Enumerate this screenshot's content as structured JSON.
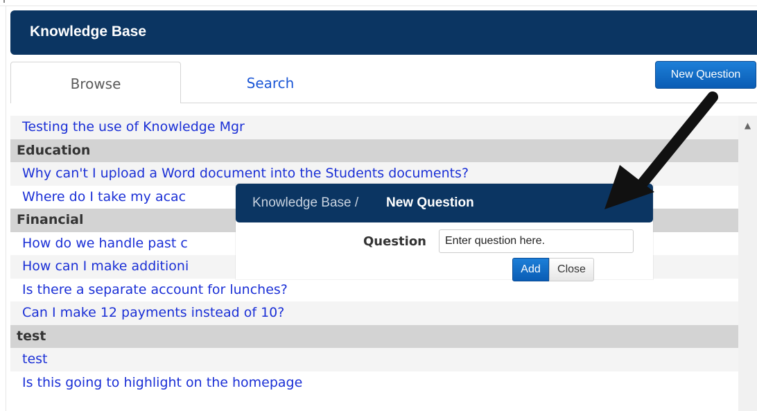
{
  "app": {
    "title": "Knowledge Base"
  },
  "tabs": [
    {
      "label": "Browse",
      "active": true
    },
    {
      "label": "Search",
      "active": false
    }
  ],
  "toolbar": {
    "new_question_label": "New Question"
  },
  "list": {
    "rows": [
      {
        "type": "item",
        "text": "Testing the use of Knowledge Mgr"
      },
      {
        "type": "category",
        "text": "Education"
      },
      {
        "type": "item",
        "text": "Why can't I upload a Word document into the Students documents?"
      },
      {
        "type": "item",
        "text": "Where do I take my acac"
      },
      {
        "type": "category",
        "text": "Financial"
      },
      {
        "type": "item",
        "text": "How do we handle past c"
      },
      {
        "type": "item",
        "text": "How can I make additioni"
      },
      {
        "type": "item",
        "text": "Is there a separate account for lunches?"
      },
      {
        "type": "item",
        "text": "Can I make 12 payments instead of 10?"
      },
      {
        "type": "category",
        "text": "test"
      },
      {
        "type": "item",
        "text": "test"
      },
      {
        "type": "item",
        "text": "Is this going to highlight on the homepage"
      }
    ]
  },
  "scrollbar": {
    "up_icon": "chevron-up-icon"
  },
  "dialog": {
    "breadcrumb": "Knowledge Base /",
    "title": "New Question",
    "question_label": "Question",
    "question_placeholder": "Enter question here.",
    "add_label": "Add",
    "close_label": "Close"
  },
  "annotation": {
    "icon": "arrow-icon",
    "color": "#111111"
  },
  "colors": {
    "header_bg": "#0b3562",
    "link": "#1a2fd6",
    "button_blue": "#0a5cb4"
  }
}
